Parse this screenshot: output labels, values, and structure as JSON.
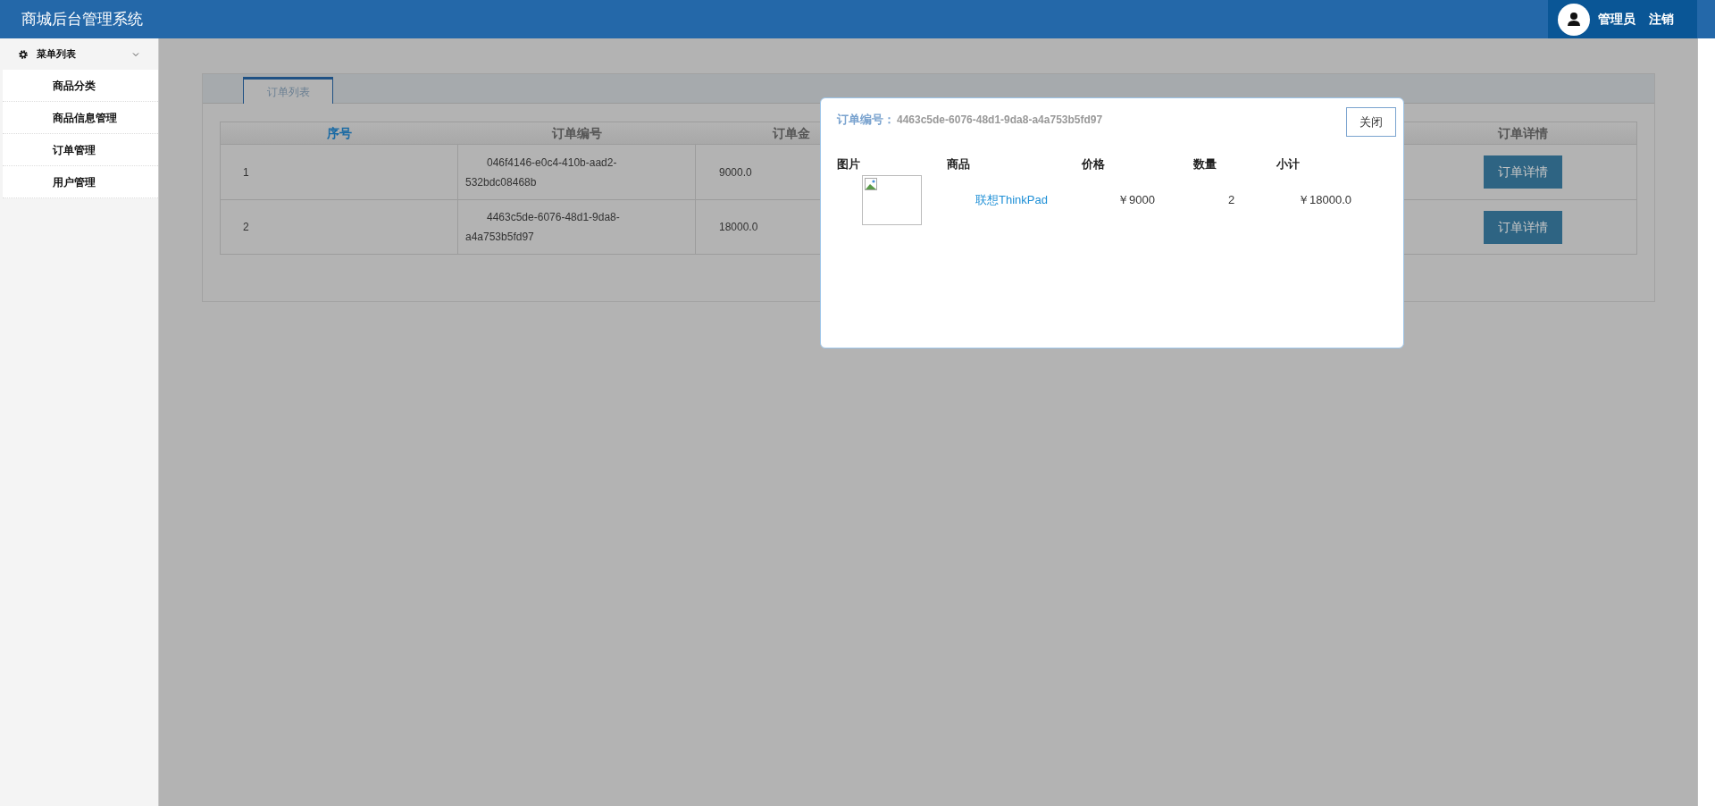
{
  "header": {
    "title": "商城后台管理系统",
    "user": "管理员",
    "logout": "注销"
  },
  "sidebar": {
    "menu_title": "菜单列表",
    "expanded": true,
    "items": [
      {
        "label": "商品分类",
        "selected": false
      },
      {
        "label": "商品信息管理",
        "selected": false
      },
      {
        "label": "订单管理",
        "selected": false
      },
      {
        "label": "用户管理",
        "selected": false
      }
    ]
  },
  "tabs": [
    {
      "label": "订单列表",
      "selected": true
    }
  ],
  "table": {
    "columns": [
      {
        "label": "序号",
        "highlighted": true
      },
      {
        "label": "订单编号",
        "highlighted": false
      },
      {
        "label": "订单金",
        "highlighted": false
      },
      {
        "label": "订单详情",
        "highlighted": false
      }
    ],
    "rows": [
      {
        "index": "1",
        "order_no": "046f4146-e0c4-410b-aad2-532bdc08468b",
        "amount": "9000.0",
        "action": "订单详情"
      },
      {
        "index": "2",
        "order_no": "4463c5de-6076-48d1-9da8-a4a753b5fd97",
        "amount": "18000.0",
        "action": "订单详情"
      }
    ]
  },
  "modal": {
    "title_label": "订单编号：",
    "order_no": "4463c5de-6076-48d1-9da8-a4a753b5fd97",
    "close": "关闭",
    "columns": [
      "图片",
      "商品",
      "价格",
      "数量",
      "小计"
    ],
    "items": [
      {
        "name": "联想ThinkPad",
        "price": "￥9000",
        "quantity": "2",
        "subtotal": "￥18000.0"
      }
    ]
  }
}
